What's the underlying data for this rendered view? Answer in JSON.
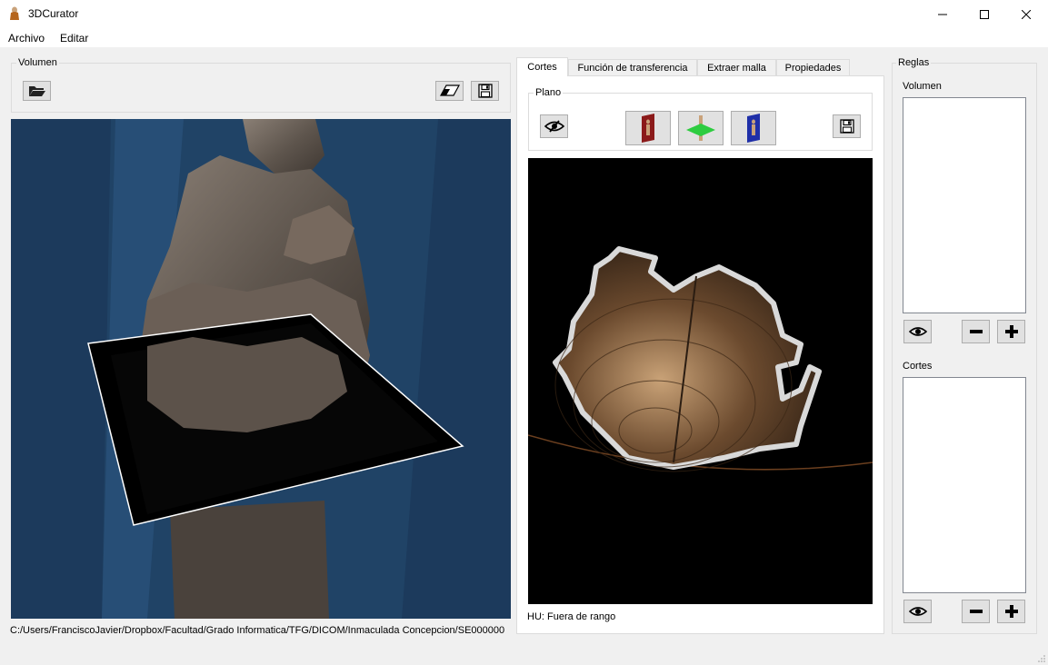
{
  "window": {
    "title": "3DCurator"
  },
  "menu": {
    "items": [
      "Archivo",
      "Editar"
    ]
  },
  "volume_panel": {
    "title": "Volumen",
    "path": "C:/Users/FranciscoJavier/Dropbox/Facultad/Grado Informatica/TFG/DICOM/Inmaculada Concepcion/SE000000"
  },
  "tabs": [
    "Cortes",
    "Función de transferencia",
    "Extraer malla",
    "Propiedades"
  ],
  "active_tab": "Cortes",
  "plane_group": {
    "title": "Plano"
  },
  "slice": {
    "hu_text": "HU: Fuera de rango"
  },
  "rules_panel": {
    "title": "Reglas",
    "volume_label": "Volumen",
    "cuts_label": "Cortes"
  },
  "colors": {
    "background": "#f0f0f0",
    "volume_view_bg": "#1c3a5c",
    "plane_red": "#8b1a1a",
    "plane_green": "#2ecc40",
    "plane_blue": "#1f2fa8"
  }
}
